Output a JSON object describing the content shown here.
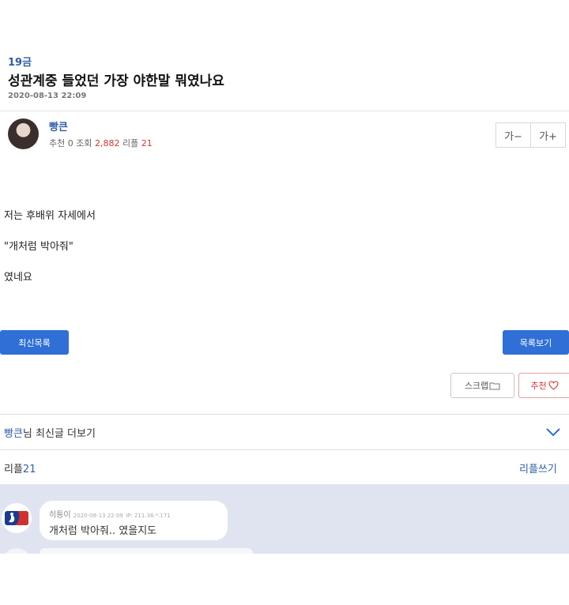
{
  "post": {
    "category": "19금",
    "title": "성관계중 들었던 가장 야한말 뭐였나요",
    "datetime": "2020-08-13 22:09",
    "author": "빵큰",
    "stats": {
      "rec_label": "추천",
      "rec": "0",
      "views_label": "조회",
      "views": "2,882",
      "replies_label": "리플",
      "replies": "21"
    },
    "font_minus": "가−",
    "font_plus": "가+",
    "body": [
      "저는 후배위 자세에서",
      "\"개처럼 박아줘\"",
      "였네요"
    ]
  },
  "buttons": {
    "latest_list": "최신목록",
    "view_list": "목록보기",
    "scrap": "스크랩",
    "recommend": "추천"
  },
  "more_posts": {
    "nick": "빵큰",
    "text": "님 최신글 더보기"
  },
  "replies": {
    "label": "리플",
    "count": "21",
    "write": "리플쓰기",
    "items": [
      {
        "nick": "히틍이",
        "datetime": "2020-08-13 22:09",
        "ip": "IP: 211.36.*.171",
        "text": "개처럼 박아줘.. 였을지도"
      }
    ]
  },
  "icons": {
    "chevron": "chevron-down-icon",
    "scrap": "folder-icon",
    "recommend": "heart-icon",
    "comment_avatar": "mlb-logo-icon"
  },
  "colors": {
    "accent": "#2f6fd6",
    "link": "#2f5fa8",
    "highlight": "#dd3333",
    "reply_bg": "#dfe4f0"
  }
}
